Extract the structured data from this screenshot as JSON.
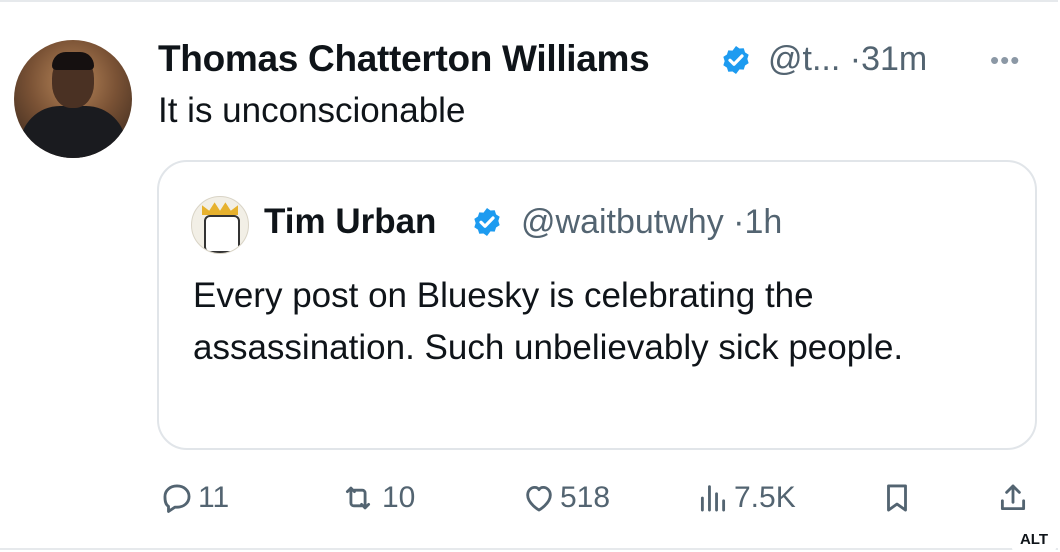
{
  "tweet": {
    "author_name": "Thomas Chatterton Williams",
    "handle": "@t...",
    "separator": "·",
    "time": "31m",
    "text": "It is unconscionable",
    "verified_icon": "verified-badge-icon",
    "more_icon": "more-dots-icon"
  },
  "quote": {
    "author_name": "Tim Urban",
    "handle": "@waitbutwhy",
    "separator": "·",
    "time": "1h",
    "text": "Every post on Bluesky is celebrating the assassination. Such unbelievably sick people."
  },
  "actions": {
    "replies": "11",
    "reposts": "10",
    "likes": "518",
    "views": "7.5K"
  },
  "badge": {
    "alt": "ALT"
  },
  "colors": {
    "verified": "#1d9bf0",
    "muted": "#536471",
    "border": "#e1e5e9"
  }
}
